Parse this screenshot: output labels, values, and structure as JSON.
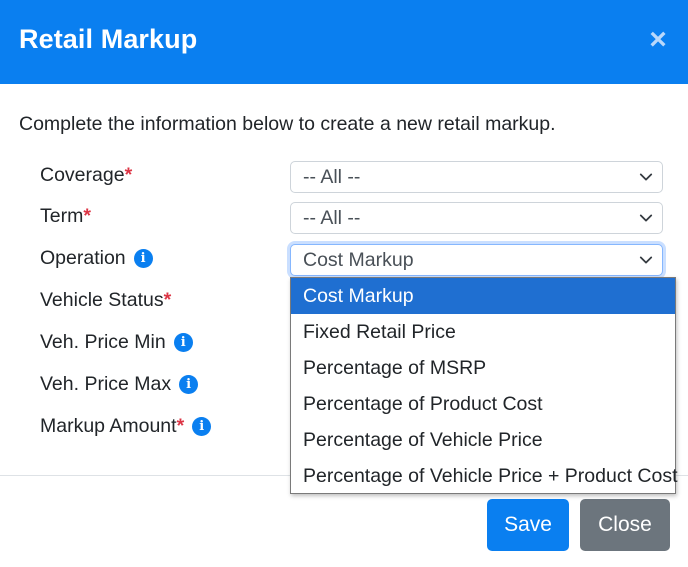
{
  "modal": {
    "title": "Retail Markup",
    "close_icon": "×",
    "intro": "Complete the information below to create a new retail markup."
  },
  "fields": {
    "coverage": {
      "label": "Coverage",
      "required_mark": "*",
      "value": "-- All --"
    },
    "term": {
      "label": "Term",
      "required_mark": "*",
      "value": "-- All --"
    },
    "operation": {
      "label": "Operation",
      "info_icon": "i",
      "value": "Cost Markup"
    },
    "vehicle_status": {
      "label": "Vehicle Status",
      "required_mark": "*"
    },
    "veh_price_min": {
      "label": "Veh. Price Min",
      "info_icon": "i"
    },
    "veh_price_max": {
      "label": "Veh. Price Max",
      "info_icon": "i"
    },
    "markup_amount": {
      "label": "Markup Amount",
      "required_mark": "*",
      "info_icon": "i"
    }
  },
  "operation_dropdown": {
    "options": [
      "Cost Markup",
      "Fixed Retail Price",
      "Percentage of MSRP",
      "Percentage of Product Cost",
      "Percentage of Vehicle Price",
      "Percentage of Vehicle Price + Product Cost"
    ],
    "selected_index": 0
  },
  "buttons": {
    "save": "Save",
    "close": "Close"
  },
  "colors": {
    "header": "#0a7ff0",
    "required": "#dc3545",
    "info": "#0a7ff0",
    "selected_option": "#1f6fd1",
    "save_button": "#0a7ff0",
    "close_button": "#6c757d"
  }
}
